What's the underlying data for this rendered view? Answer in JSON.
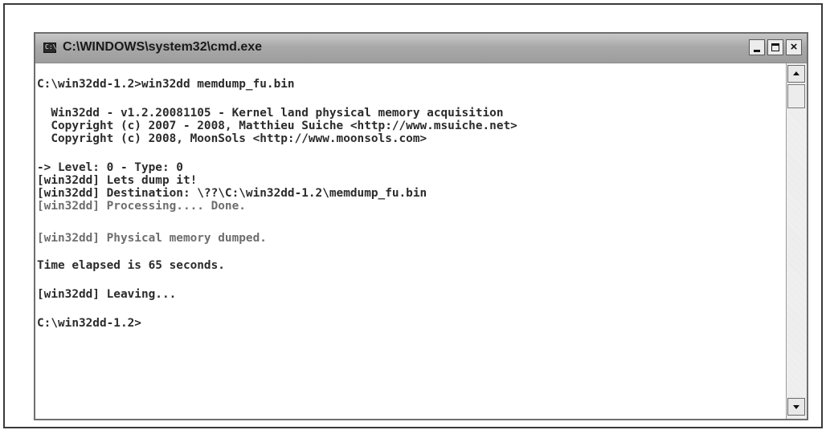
{
  "window": {
    "title": "C:\\WINDOWS\\system32\\cmd.exe",
    "icon": "cmd-icon",
    "buttons": {
      "minimize": "minimize-icon",
      "maximize": "maximize-icon",
      "close": "×"
    }
  },
  "console": {
    "lines": [
      "C:\\win32dd-1.2>win32dd memdump_fu.bin",
      "  Win32dd - v1.2.20081105 - Kernel land physical memory acquisition",
      "  Copyright (c) 2007 - 2008, Matthieu Suiche <http://www.msuiche.net>",
      "  Copyright (c) 2008, MoonSols <http://www.moonsols.com>",
      "-> Level: 0 - Type: 0",
      "[win32dd] Lets dump it!",
      "[win32dd] Destination: \\??\\C:\\win32dd-1.2\\memdump_fu.bin",
      "[win32dd] Processing.... Done.",
      "[win32dd] Physical memory dumped.",
      "Time elapsed is 65 seconds.",
      "[win32dd] Leaving...",
      "C:\\win32dd-1.2>"
    ]
  },
  "scrollbar": {
    "up_icon": "scroll-up-arrow-icon",
    "down_icon": "scroll-down-arrow-icon"
  }
}
